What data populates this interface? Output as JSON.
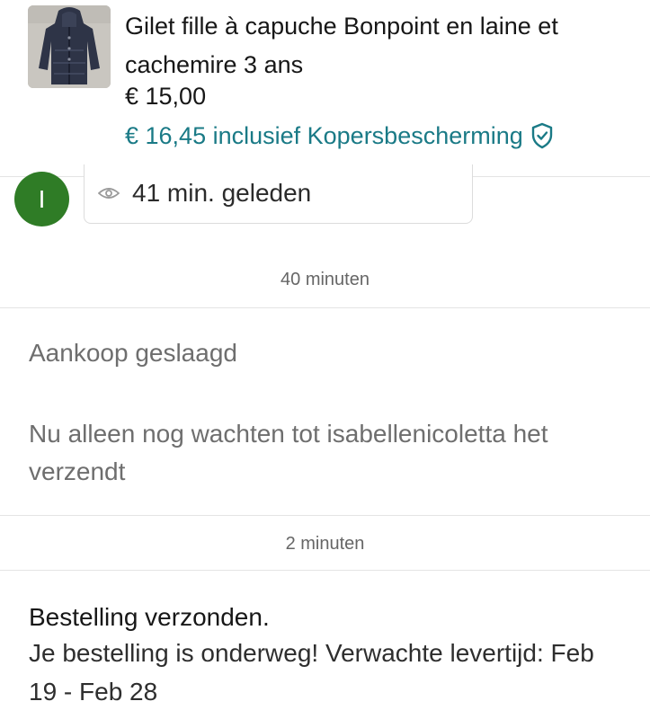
{
  "item": {
    "title": "Gilet fille à capuche Bonpoint en laine et cachemire 3 ans",
    "price": "€ 15,00",
    "protection_text": "€ 16,45 inclusief Kopersbescherming",
    "protection_icon": "shield-check-icon",
    "accent_color": "#1a7a86"
  },
  "message": {
    "avatar_initial": "I",
    "avatar_color": "#2f7c26",
    "seen_icon": "eye-icon",
    "seen_text": "41 min. geleden"
  },
  "timeline": [
    {
      "timestamp": "40 minuten",
      "title": "Aankoop geslaagd",
      "body": "Nu alleen nog wachten tot isabellenicoletta het verzendt"
    },
    {
      "timestamp": "2 minuten",
      "title": "Bestelling verzonden.",
      "body": "Je bestelling is onderweg! Verwachte levertijd: Feb 19 - Feb 28"
    }
  ]
}
